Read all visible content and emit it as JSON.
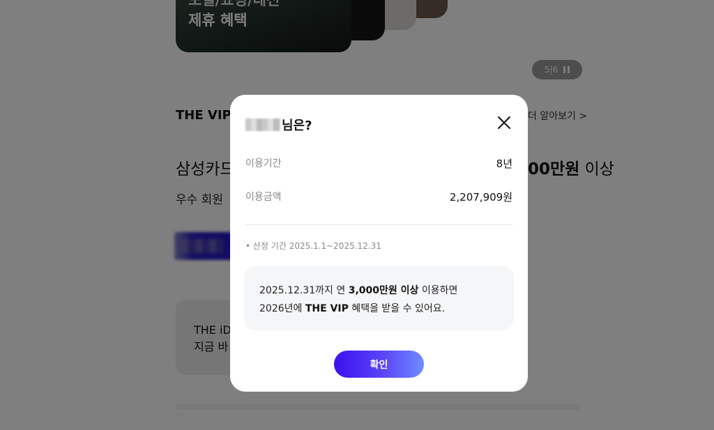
{
  "background": {
    "card": {
      "line1": "모빌/쇼핑/레전",
      "line2": "제휴 혜택"
    },
    "pager": {
      "current": "5",
      "separator": "|",
      "total": "6"
    },
    "vip_title": "THE VIP",
    "more_link": "더 알아보기 >",
    "headline_left": "삼성카드",
    "headline_right_amount": "00만원",
    "headline_right_tail": " 이상",
    "subline": "우수 회원",
    "idcard_line1": "THE iD",
    "idcard_line2": "지금 바"
  },
  "modal": {
    "title_suffix": "님은?",
    "rows": [
      {
        "label": "이용기간",
        "value": "8년"
      },
      {
        "label": "이용금액",
        "value": "2,207,909원"
      }
    ],
    "note": "• 산정 기간 2025.1.1~2025.12.31",
    "info": {
      "p1": "2025.12.31까지 연 ",
      "b1": "3,000만원 이상",
      "p2": " 이용하면",
      "p3": "2026년에 ",
      "b2": "THE VIP",
      "p4": " 혜택을 받을 수 있어요."
    },
    "confirm_label": "확인"
  },
  "colors": {
    "accent": "#3b10f0",
    "overlay": "rgba(0,0,0,0.5)"
  }
}
